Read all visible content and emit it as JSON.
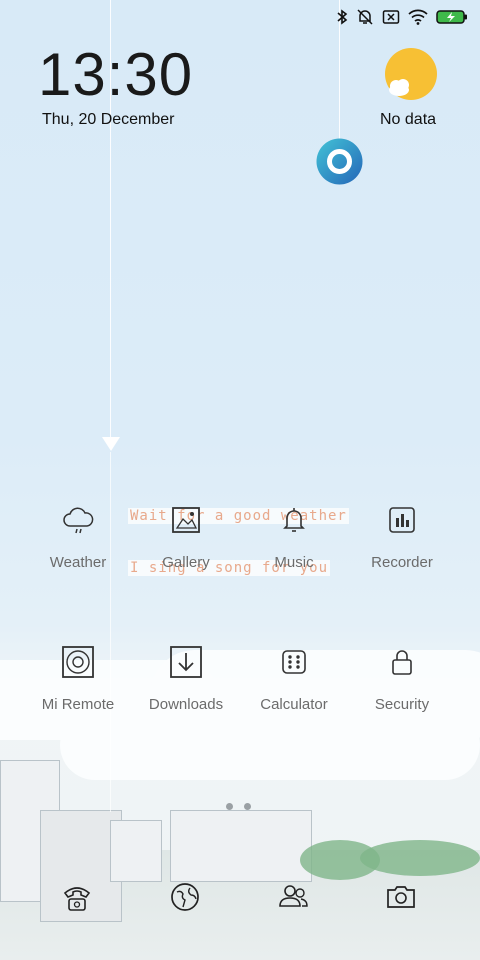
{
  "status_bar": {
    "icons": [
      "bluetooth-icon",
      "alarm-off-icon",
      "sim-off-icon",
      "wifi-icon",
      "battery-charging-icon"
    ]
  },
  "clock": {
    "time": "13:30",
    "date": "Thu, 20 December"
  },
  "weather_widget": {
    "icon": "sun-cloud-icon",
    "label": "No data"
  },
  "overlay": {
    "line1": "Wait for a good weather",
    "line2": "I sing a song for you"
  },
  "apps": [
    {
      "label": "Weather",
      "icon": "weather-icon"
    },
    {
      "label": "Gallery",
      "icon": "gallery-icon"
    },
    {
      "label": "Music",
      "icon": "music-icon"
    },
    {
      "label": "Recorder",
      "icon": "recorder-icon"
    },
    {
      "label": "Mi Remote",
      "icon": "mi-remote-icon"
    },
    {
      "label": "Downloads",
      "icon": "downloads-icon"
    },
    {
      "label": "Calculator",
      "icon": "calculator-icon"
    },
    {
      "label": "Security",
      "icon": "security-icon"
    }
  ],
  "page_indicator": {
    "pages": 2,
    "current": 1
  },
  "dock": [
    {
      "icon": "phone-icon"
    },
    {
      "icon": "browser-icon"
    },
    {
      "icon": "contacts-icon"
    },
    {
      "icon": "camera-icon"
    }
  ],
  "colors": {
    "accent": "#f7c034",
    "assistant": "#2f8fc7",
    "battery": "#3fb94a"
  }
}
